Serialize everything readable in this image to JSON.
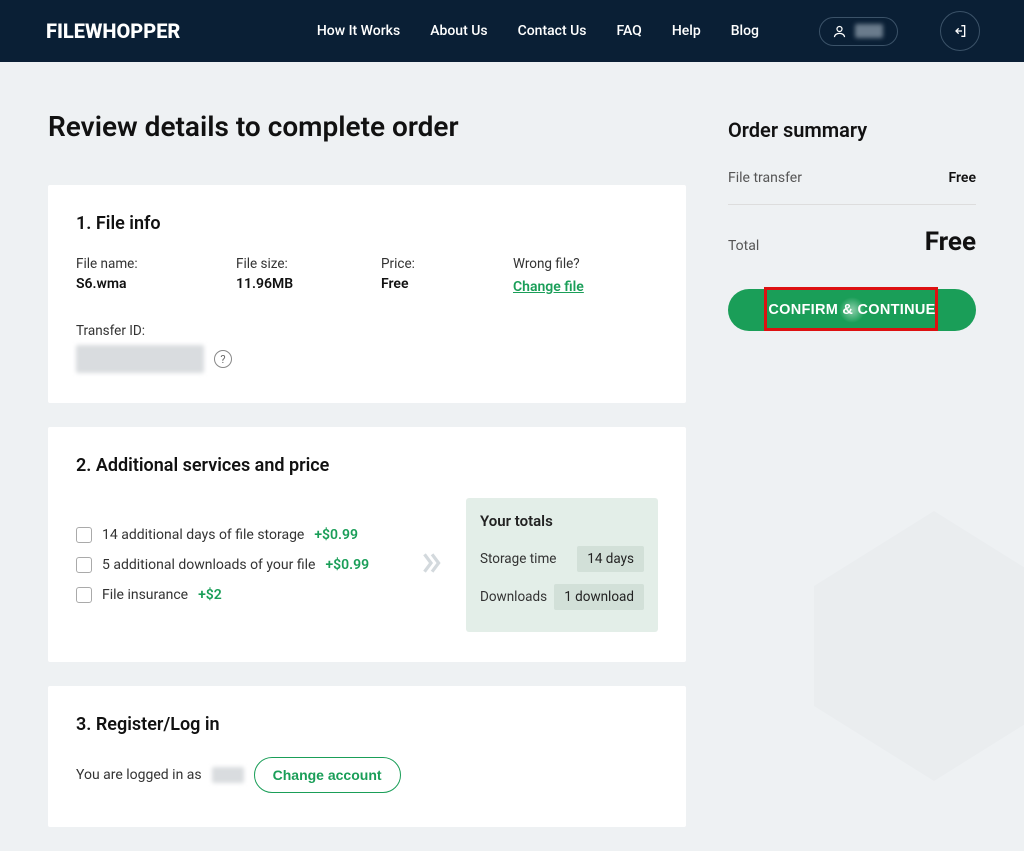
{
  "brand": "FILEWHOPPER",
  "nav": {
    "how_it_works": "How It Works",
    "about_us": "About Us",
    "contact_us": "Contact Us",
    "faq": "FAQ",
    "help": "Help",
    "blog": "Blog"
  },
  "page_title": "Review details to complete order",
  "card1": {
    "title": "1. File info",
    "file_name_label": "File name:",
    "file_name": "S6.wma",
    "file_size_label": "File size:",
    "file_size": "11.96MB",
    "price_label": "Price:",
    "price": "Free",
    "wrong_file_label": "Wrong file?",
    "change_file": "Change file",
    "transfer_id_label": "Transfer ID:",
    "help_char": "?"
  },
  "card2": {
    "title": "2. Additional services and price",
    "options": [
      {
        "label": "14 additional days of file storage",
        "price": "+$0.99"
      },
      {
        "label": "5 additional downloads of your file",
        "price": "+$0.99"
      },
      {
        "label": "File insurance",
        "price": "+$2"
      }
    ],
    "totals_title": "Your totals",
    "storage_label": "Storage time",
    "storage_value": "14 days",
    "downloads_label": "Downloads",
    "downloads_value": "1 download"
  },
  "card3": {
    "title": "3. Register/Log in",
    "logged_in_prefix": "You are logged in as",
    "change_account": "Change account"
  },
  "summary": {
    "title": "Order summary",
    "file_transfer_label": "File transfer",
    "file_transfer_value": "Free",
    "total_label": "Total",
    "total_value": "Free",
    "confirm": "CONFIRM & CONTINUE"
  }
}
